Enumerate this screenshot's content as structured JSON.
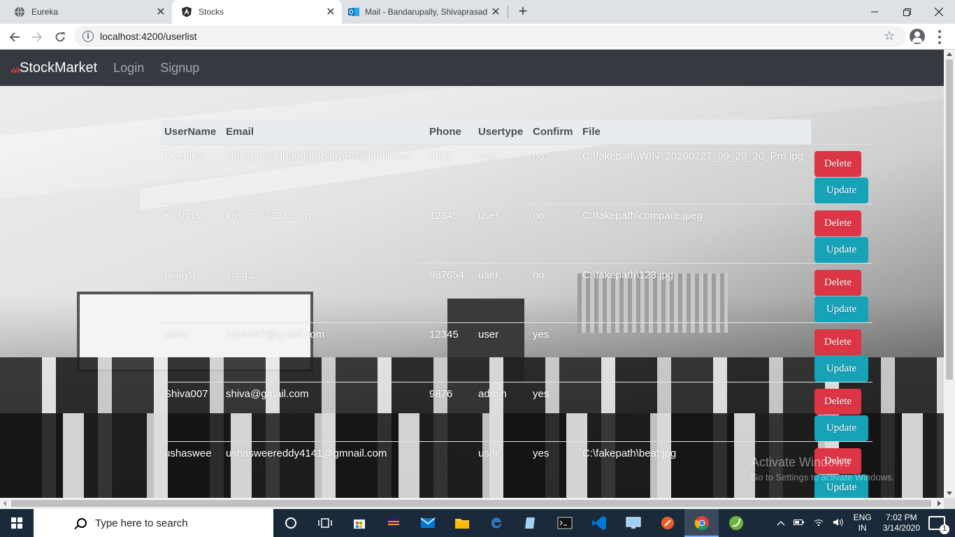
{
  "browser": {
    "tabs": [
      {
        "title": "Eureka",
        "icon": "globe-icon",
        "active": false
      },
      {
        "title": "Stocks",
        "icon": "angular-icon",
        "active": true
      },
      {
        "title": "Mail - Bandarupally, Shivaprasad",
        "icon": "outlook-icon",
        "active": false
      }
    ],
    "new_tab": "+",
    "url": "localhost:4200/userlist"
  },
  "navbar": {
    "brand": "StockMarket",
    "links": [
      "Login",
      "Signup"
    ]
  },
  "table": {
    "headers": [
      "UserName",
      "Email",
      "Phone",
      "Usertype",
      "Confirm",
      "File"
    ],
    "rows": [
      {
        "username": "Deepika",
        "email": "shivaprasadbandarupally68@gmail.com",
        "phone": "9875",
        "usertype": "user",
        "confirm": "no",
        "file": "C:\\fakepath\\WIN_20200227_09_29_20_Pro.jpg"
      },
      {
        "username": "Krishna",
        "email": "krishna@123.com",
        "phone": "12345",
        "usertype": "user",
        "confirm": "no",
        "file": "C:\\fakepath\\compare.jpeg"
      },
      {
        "username": "poiuytr",
        "email": "s@g.c",
        "phone": "987654",
        "usertype": "user",
        "confirm": "no",
        "file": "C:\\fakepath\\123.jpg"
      },
      {
        "username": "shiva",
        "email": "bsp9497@gmail.com",
        "phone": "12345",
        "usertype": "user",
        "confirm": "yes",
        "file": ""
      },
      {
        "username": "Shiva007",
        "email": "shiva@gmail.com",
        "phone": "9876",
        "usertype": "admin",
        "confirm": "yes",
        "file": ""
      },
      {
        "username": "ushaswee",
        "email": "ushasweereddy4141@gmnail.com",
        "phone": "",
        "usertype": "user",
        "confirm": "yes",
        "file": "C:\\fakepath\\beat.jpg"
      }
    ],
    "delete_label": "Delete",
    "update_label": "Update"
  },
  "watermark": {
    "title": "Activate Windows",
    "subtitle": "Go to Settings to activate Windows."
  },
  "taskbar": {
    "search_placeholder": "Type here to search",
    "language": "ENG",
    "region": "IN",
    "time": "7:02 PM",
    "date": "3/14/2020",
    "notification_count": "1"
  },
  "colors": {
    "navbar": "#343a40",
    "delete": "#dc3545",
    "update": "#17a2b8",
    "table_header": "#e9ecef"
  }
}
